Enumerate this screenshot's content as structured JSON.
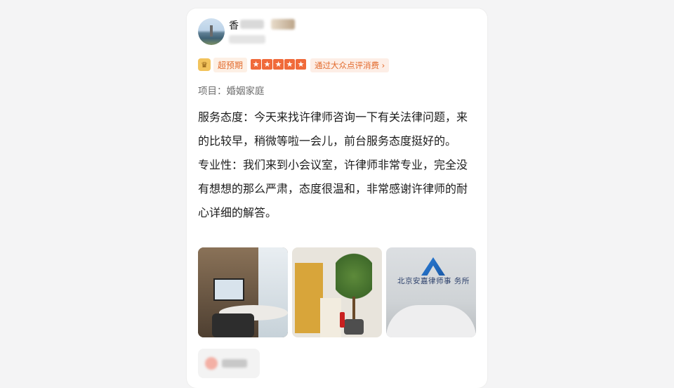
{
  "review": {
    "user": {
      "name_visible": "香"
    },
    "badge": {
      "label": "超预期",
      "stars": 5,
      "source_link": "通过大众点评消费 ›"
    },
    "project": "项目：婚姻家庭",
    "paragraphs": [
      "服务态度：今天来找许律师咨询一下有关法律问题，来的比较早，稍微等啦一会儿，前台服务态度挺好的。",
      "专业性：我们来到小会议室，许律师非常专业，完全没有想想的那么严肃，态度很温和，非常感谢许律师的耐心详细的解答。"
    ],
    "photos": [
      {
        "label": "meeting-room"
      },
      {
        "label": "lobby"
      },
      {
        "label": "reception"
      }
    ],
    "photo_text": {
      "firm_name": "北京安嘉律师事 务所"
    }
  },
  "colors": {
    "accent": "#e26a2c",
    "star": "#f06a3a"
  }
}
